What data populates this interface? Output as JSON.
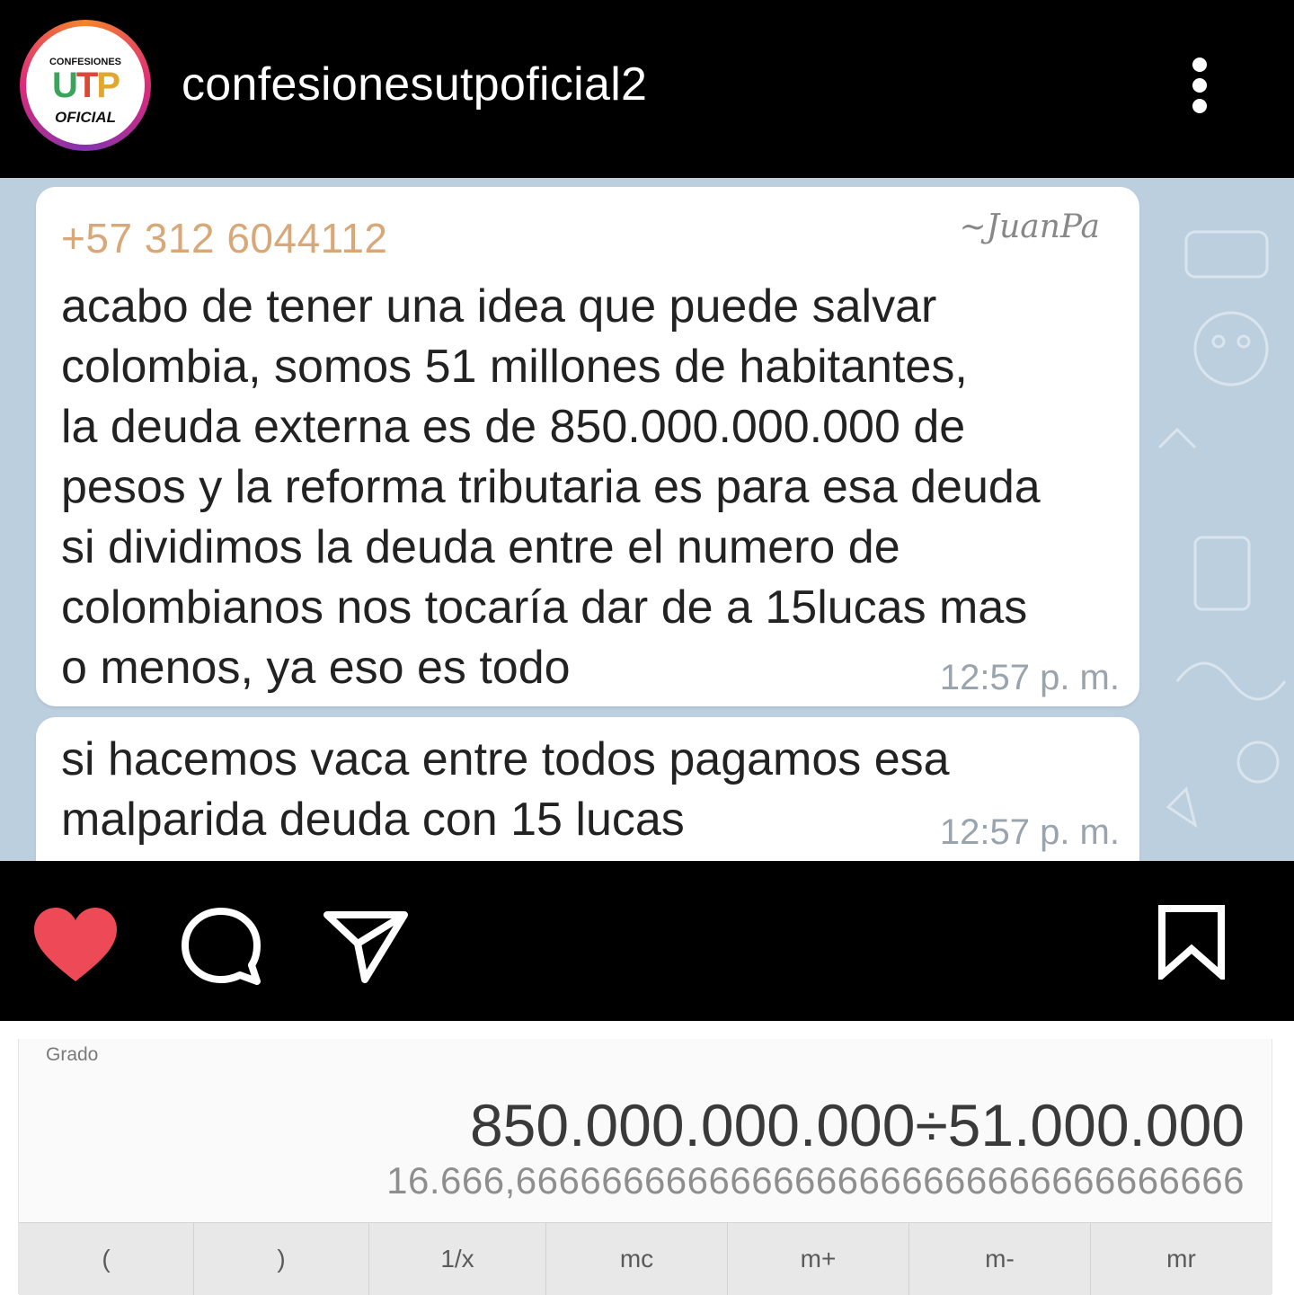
{
  "post": {
    "username": "confesionesutpoficial2",
    "avatar_logo": {
      "top_text": "CONFESIONES",
      "letters": [
        "U",
        "T",
        "P"
      ],
      "bottom_text": "OFICIAL"
    }
  },
  "chat": {
    "messages": [
      {
        "sender": "+57 312 6044112",
        "signature": "~JuanPa",
        "text": "acabo de tener una idea que puede salvar\ncolombia, somos 51 millones de habitantes,\nla deuda externa es de 850.000.000.000 de\npesos y la reforma tributaria es para esa deuda\nsi dividimos la deuda entre el numero de\ncolombianos nos tocaría dar de a 15lucas mas\no menos, ya eso es todo",
        "time": "12:57 p. m."
      },
      {
        "text": "si hacemos vaca entre todos pagamos esa\nmalparida deuda con 15 lucas",
        "time": "12:57 p. m."
      }
    ]
  },
  "actions": {
    "icons": [
      "heart-icon",
      "comment-icon",
      "share-icon",
      "bookmark-icon"
    ],
    "liked": true,
    "like_color": "#ed4956"
  },
  "calculator": {
    "mode": "Grado",
    "expression": "850.000.000.000÷51.000.000",
    "result": "16.666,6666666666666666666666666666666666",
    "keys": [
      "(",
      ")",
      "1/x",
      "mc",
      "m+",
      "m-",
      "mr"
    ]
  }
}
